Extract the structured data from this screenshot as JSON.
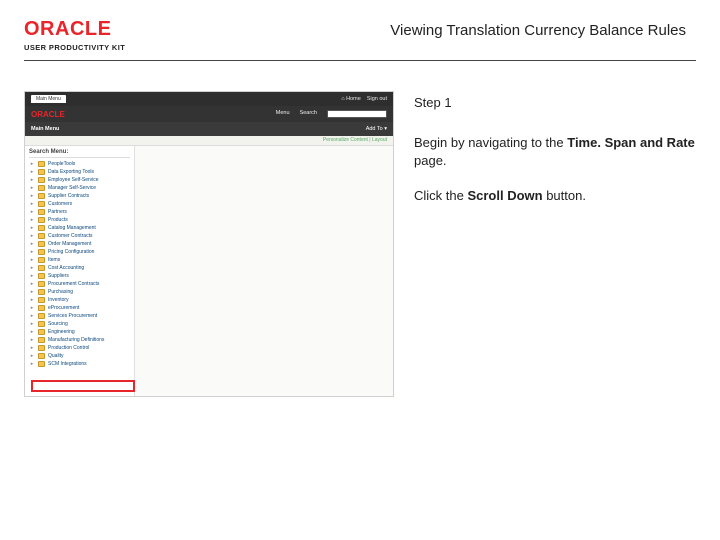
{
  "header": {
    "logo_text": "ORACLE",
    "logo_subtext": "USER PRODUCTIVITY KIT",
    "title": "Viewing Translation Currency Balance Rules"
  },
  "instructions": {
    "step_label": "Step 1",
    "p1_pre": "Begin by navigating to the ",
    "p1_bold": "Time. Span and Rate",
    "p1_post": " page.",
    "p2_pre": "Click the ",
    "p2_bold": "Scroll Down",
    "p2_post": " button."
  },
  "screenshot": {
    "top_tabs": [
      "...",
      "Main Menu"
    ],
    "top_right": [
      "Home",
      "Sign out"
    ],
    "brand": "ORACLE",
    "searchmenu": [
      "Menu",
      "Search"
    ],
    "toolbar_title": "Main Menu",
    "toolbar_items": [
      "Add To ▾",
      ""
    ],
    "crumb": "Personalize Content | Layout",
    "tree_title": "Search Menu:",
    "tree": [
      "PeopleTools",
      "Data Exporting Tools",
      "Employee Self-Service",
      "Manager Self-Service",
      "Supplier Contracts",
      "Customers",
      "Partners",
      "Products",
      "Catalog Management",
      "Customer Contracts",
      "Order Management",
      "Pricing Configuration",
      "Items",
      "Cost Accounting",
      "Suppliers",
      "Procurement Contracts",
      "Purchasing",
      "Inventory",
      "eProcurement",
      "Services Procurement",
      "Sourcing",
      "Engineering",
      "Manufacturing Definitions",
      "Production Control",
      "Quality",
      "SCM Integrations"
    ]
  }
}
